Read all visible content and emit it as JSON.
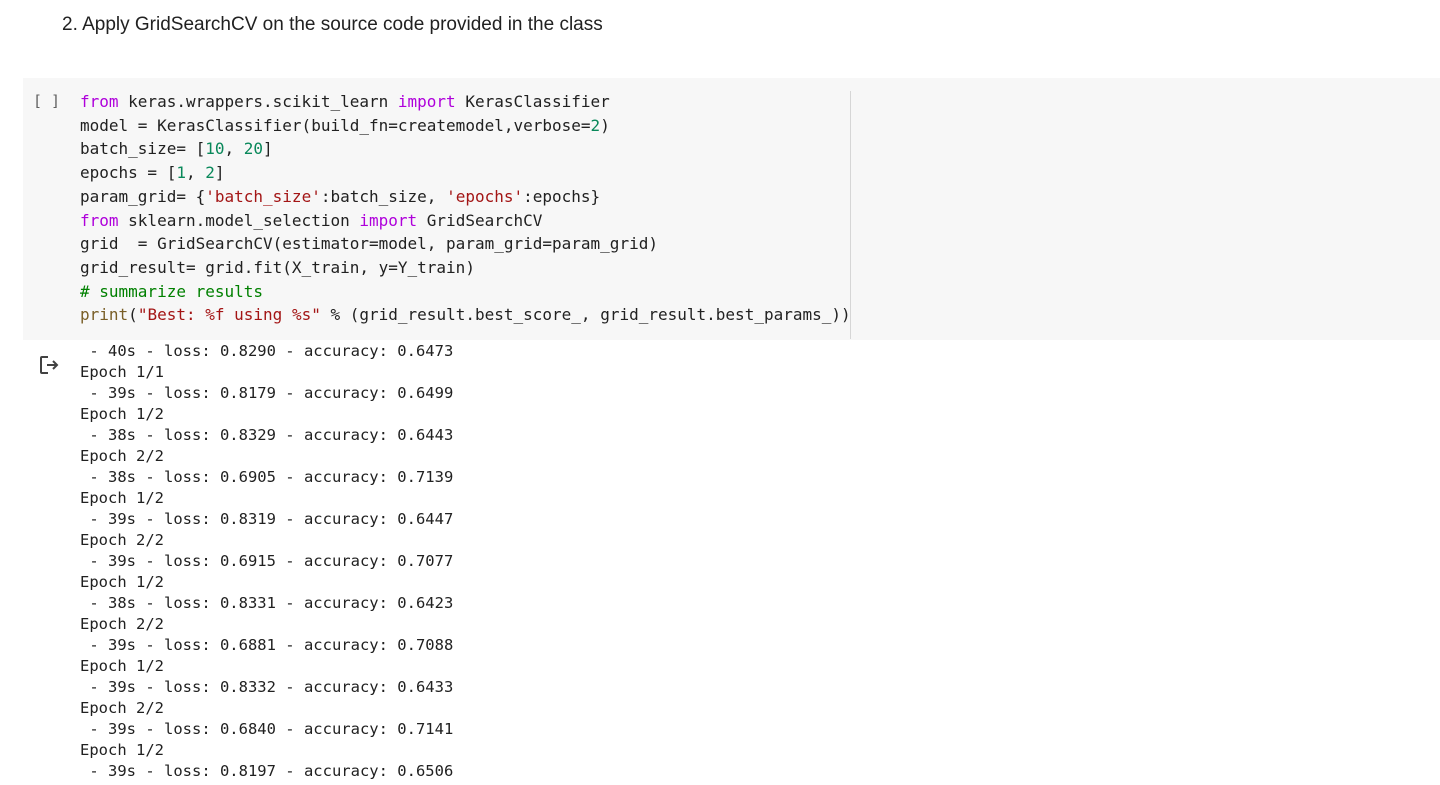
{
  "heading": "2. Apply GridSearchCV on the source code provided in the class",
  "cell": {
    "run_indicator": "[ ]",
    "code": {
      "l1": {
        "a": "from",
        "b": " keras.wrappers.scikit_learn ",
        "c": "import",
        "d": " KerasClassifier"
      },
      "l2": {
        "a": "model = KerasClassifier(build_fn=createmodel,verbose=",
        "b": "2",
        "c": ")"
      },
      "l3": {
        "a": "batch_size= [",
        "b": "10",
        "c": ", ",
        "d": "20",
        "e": "]"
      },
      "l4": {
        "a": "epochs = [",
        "b": "1",
        "c": ", ",
        "d": "2",
        "e": "]"
      },
      "l5": {
        "a": "param_grid= {",
        "b": "'batch_size'",
        "c": ":batch_size, ",
        "d": "'epochs'",
        "e": ":epochs}"
      },
      "l6": {
        "a": "from",
        "b": " sklearn.model_selection ",
        "c": "import",
        "d": " GridSearchCV"
      },
      "l7": {
        "a": "grid  = GridSearchCV(estimator=model, param_grid=param_grid)"
      },
      "l8": {
        "a": "grid_result= grid.fit(X_train, y=Y_train)"
      },
      "l9": {
        "a": "# summarize results"
      },
      "l10": {
        "a": "print",
        "b": "(",
        "c": "\"Best: %f using %s\"",
        "d": " % (grid_result.best_score_, grid_result.best_params_))"
      }
    }
  },
  "output": {
    "icon": "output-redirect-icon",
    "lines": [
      " - 40s - loss: 0.8290 - accuracy: 0.6473",
      "Epoch 1/1",
      " - 39s - loss: 0.8179 - accuracy: 0.6499",
      "Epoch 1/2",
      " - 38s - loss: 0.8329 - accuracy: 0.6443",
      "Epoch 2/2",
      " - 38s - loss: 0.6905 - accuracy: 0.7139",
      "Epoch 1/2",
      " - 39s - loss: 0.8319 - accuracy: 0.6447",
      "Epoch 2/2",
      " - 39s - loss: 0.6915 - accuracy: 0.7077",
      "Epoch 1/2",
      " - 38s - loss: 0.8331 - accuracy: 0.6423",
      "Epoch 2/2",
      " - 39s - loss: 0.6881 - accuracy: 0.7088",
      "Epoch 1/2",
      " - 39s - loss: 0.8332 - accuracy: 0.6433",
      "Epoch 2/2",
      " - 39s - loss: 0.6840 - accuracy: 0.7141",
      "Epoch 1/2",
      " - 39s - loss: 0.8197 - accuracy: 0.6506"
    ]
  }
}
